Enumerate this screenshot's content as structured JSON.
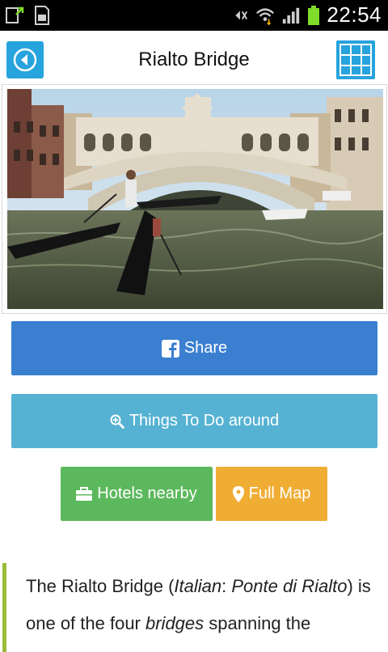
{
  "status_bar": {
    "time": "22:54"
  },
  "header": {
    "title": "Rialto Bridge"
  },
  "photo": {
    "alt": "Rialto Bridge photo"
  },
  "buttons": {
    "share": "Share",
    "things_to_do": "Things To Do around",
    "hotels": "Hotels nearby",
    "full_map": "Full Map"
  },
  "description": {
    "part1": "The Rialto Bridge (",
    "italian": "Italian",
    "colon": ": ",
    "ponte": "Ponte di Rialto",
    "part2": ") is one of the four ",
    "bridges": "bridges",
    "part3": " spanning the"
  },
  "colors": {
    "accent_blue": "#27a3dd",
    "share_blue": "#3a7fd0",
    "todo_teal": "#55b2d2",
    "hotels_green": "#5cb85c",
    "map_orange": "#f0ad34",
    "quote_bar": "#9bbb3a"
  }
}
